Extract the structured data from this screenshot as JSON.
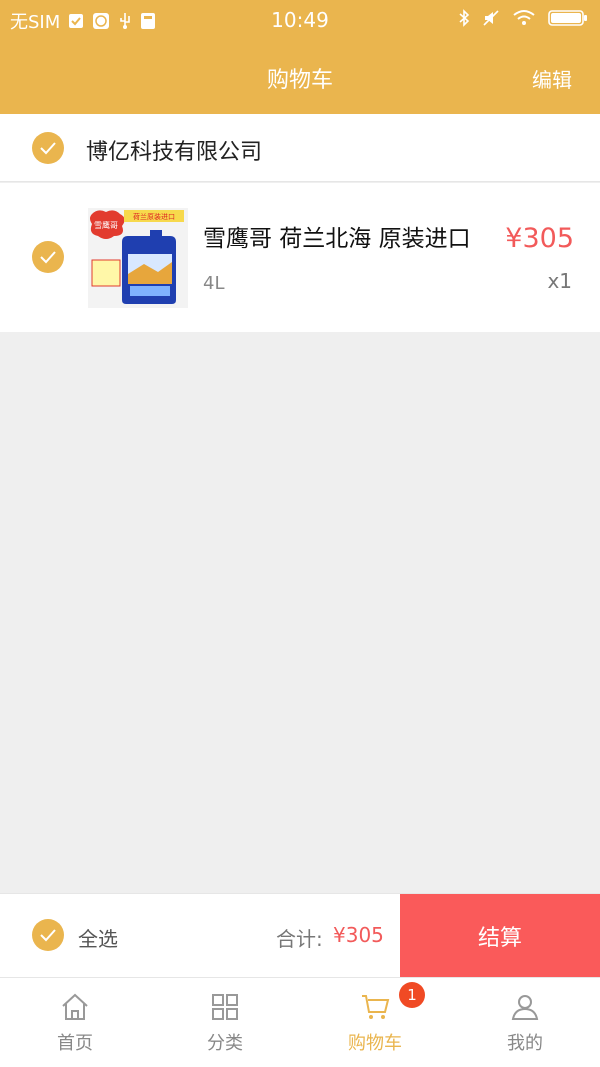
{
  "status_bar": {
    "carrier": "无SIM",
    "time": "10:49"
  },
  "nav": {
    "title": "购物车",
    "edit_label": "编辑"
  },
  "cart": {
    "store_name": "博亿科技有限公司",
    "items": [
      {
        "title": "雪鹰哥 荷兰北海 原装进口",
        "spec": "4L",
        "price": "¥305",
        "qty": "x1",
        "thumb_text": {
          "brand": "雪鹰哥",
          "banner": "荷兰原装进口"
        }
      }
    ]
  },
  "checkout": {
    "select_all_label": "全选",
    "total_label": "合计:",
    "total_value": "¥305",
    "settle_label": "结算"
  },
  "tabs": [
    {
      "label": "首页",
      "icon": "home-icon"
    },
    {
      "label": "分类",
      "icon": "grid-icon"
    },
    {
      "label": "购物车",
      "icon": "cart-icon",
      "badge": "1"
    },
    {
      "label": "我的",
      "icon": "user-icon"
    }
  ],
  "colors": {
    "accent": "#eab54e",
    "price": "#f25a5a",
    "settle": "#fa5a5a",
    "badge": "#f04a24"
  }
}
